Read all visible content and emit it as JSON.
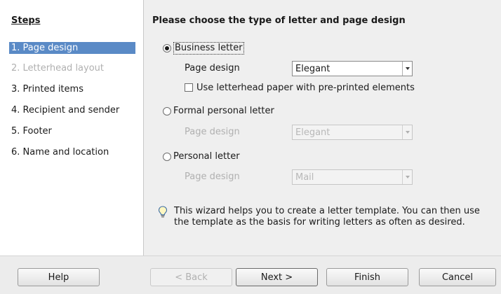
{
  "sidebar": {
    "title": "Steps",
    "steps": [
      {
        "label": "1. Page design"
      },
      {
        "label": "2. Letterhead layout"
      },
      {
        "label": "3. Printed items"
      },
      {
        "label": "4. Recipient and sender"
      },
      {
        "label": "5. Footer"
      },
      {
        "label": "6. Name and location"
      }
    ]
  },
  "main": {
    "title": "Please choose the type of letter and page design",
    "options": [
      {
        "label": "Business letter",
        "checked": true,
        "page_design_label": "Page design",
        "page_design_value": "Elegant"
      },
      {
        "label": "Formal personal letter",
        "checked": false,
        "page_design_label": "Page design",
        "page_design_value": "Elegant"
      },
      {
        "label": "Personal letter",
        "checked": false,
        "page_design_label": "Page design",
        "page_design_value": "Mail"
      }
    ],
    "letterhead_checkbox": "Use letterhead paper with pre-printed elements",
    "hint": "This wizard helps you to create a letter template. You can then use the template as the basis for writing letters as often as desired."
  },
  "buttons": {
    "help": "Help",
    "back": "< Back",
    "next": "Next >",
    "finish": "Finish",
    "cancel": "Cancel"
  },
  "colors": {
    "active_step": "#5a8ac6",
    "disabled_text": "#b0b0b0"
  }
}
